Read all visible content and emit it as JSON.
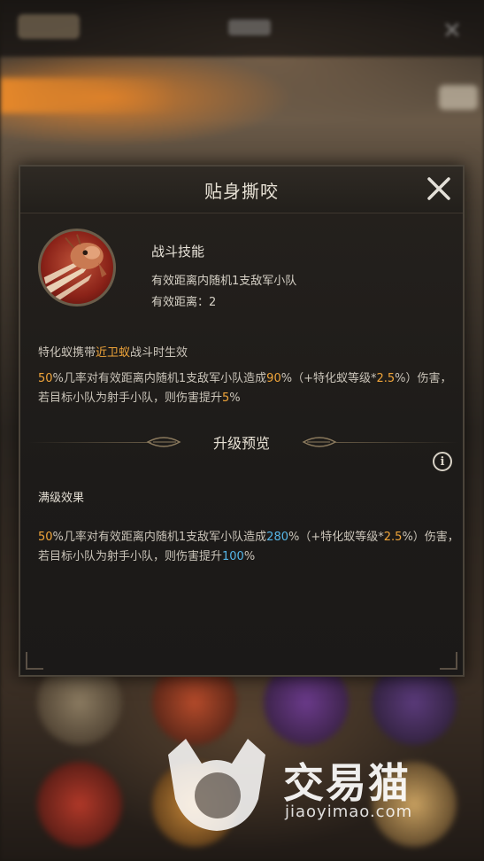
{
  "dialog": {
    "title": "贴身撕咬",
    "skill_type": "战斗技能",
    "skill_target": "有效距离内随机1支敌军小队",
    "skill_range_label": "有效距离：",
    "skill_range_value": "2",
    "condition": {
      "pre": "特化蚁携带",
      "highlight": "近卫蚁",
      "post": "战斗时生效"
    },
    "effect": {
      "p1": "50",
      "t1": "%几率对有效距离内随机1支敌军小队造成",
      "p2": "90",
      "t2": "%（+特化蚁等级*",
      "p3": "2.5",
      "t3": "%）伤害，若目标小队为射手小队，则伤害提升",
      "p4": "5",
      "t4": "%"
    },
    "upgrade_title": "升级预览",
    "max_label": "满级效果",
    "max_effect": {
      "p1": "50",
      "t1": "%几率对有效距离内随机1支敌军小队造成",
      "p2": "280",
      "t2": "%（+特化蚁等级*",
      "p3": "2.5",
      "t3": "%）伤害，若目标小队为射手小队，则伤害提升",
      "p4": "100",
      "t4": "%"
    }
  },
  "watermark": {
    "name": "交易猫",
    "url": "jiaoyimao.com"
  },
  "colors": {
    "highlight_orange": "#f0a53a",
    "highlight_blue": "#55b6e8",
    "text": "#c9c3b8"
  }
}
